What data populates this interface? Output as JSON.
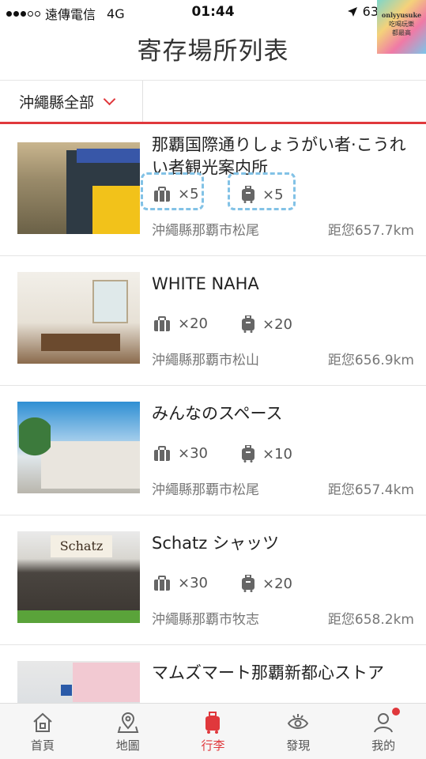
{
  "status_bar": {
    "carrier": "遠傳電信",
    "network": "4G",
    "time": "01:44",
    "battery": "63"
  },
  "sticker": {
    "line1": "onlyyusuke",
    "line2": "吃喝玩樂",
    "line3": "都最高"
  },
  "header": {
    "title": "寄存場所列表"
  },
  "filter": {
    "region": "沖繩縣全部"
  },
  "listings": [
    {
      "name": "那覇国際通りしょうがい者·こうれい者観光案内所",
      "bags": "×5",
      "suitcases": "×5",
      "location": "沖繩縣那覇市松尾",
      "distance": "距您657.7km"
    },
    {
      "name": "WHITE NAHA",
      "bags": "×20",
      "suitcases": "×20",
      "location": "沖繩縣那覇市松山",
      "distance": "距您656.9km"
    },
    {
      "name": "みんなのスペース",
      "bags": "×30",
      "suitcases": "×10",
      "location": "沖繩縣那覇市松尾",
      "distance": "距您657.4km"
    },
    {
      "name": "Schatz シャッツ",
      "bags": "×30",
      "suitcases": "×20",
      "location": "沖繩縣那覇市牧志",
      "distance": "距您658.2km"
    },
    {
      "name": "マムズマート那覇新都心ストア"
    }
  ],
  "photo_text": {
    "schatz_sign": "Schatz"
  },
  "tabs": [
    {
      "label": "首頁",
      "icon": "home-icon"
    },
    {
      "label": "地圖",
      "icon": "map-pin-icon"
    },
    {
      "label": "行李",
      "icon": "luggage-icon"
    },
    {
      "label": "發現",
      "icon": "eye-icon"
    },
    {
      "label": "我的",
      "icon": "user-icon"
    }
  ],
  "colors": {
    "accent": "#e0383c",
    "highlight_dashes": "#82c2e6"
  }
}
